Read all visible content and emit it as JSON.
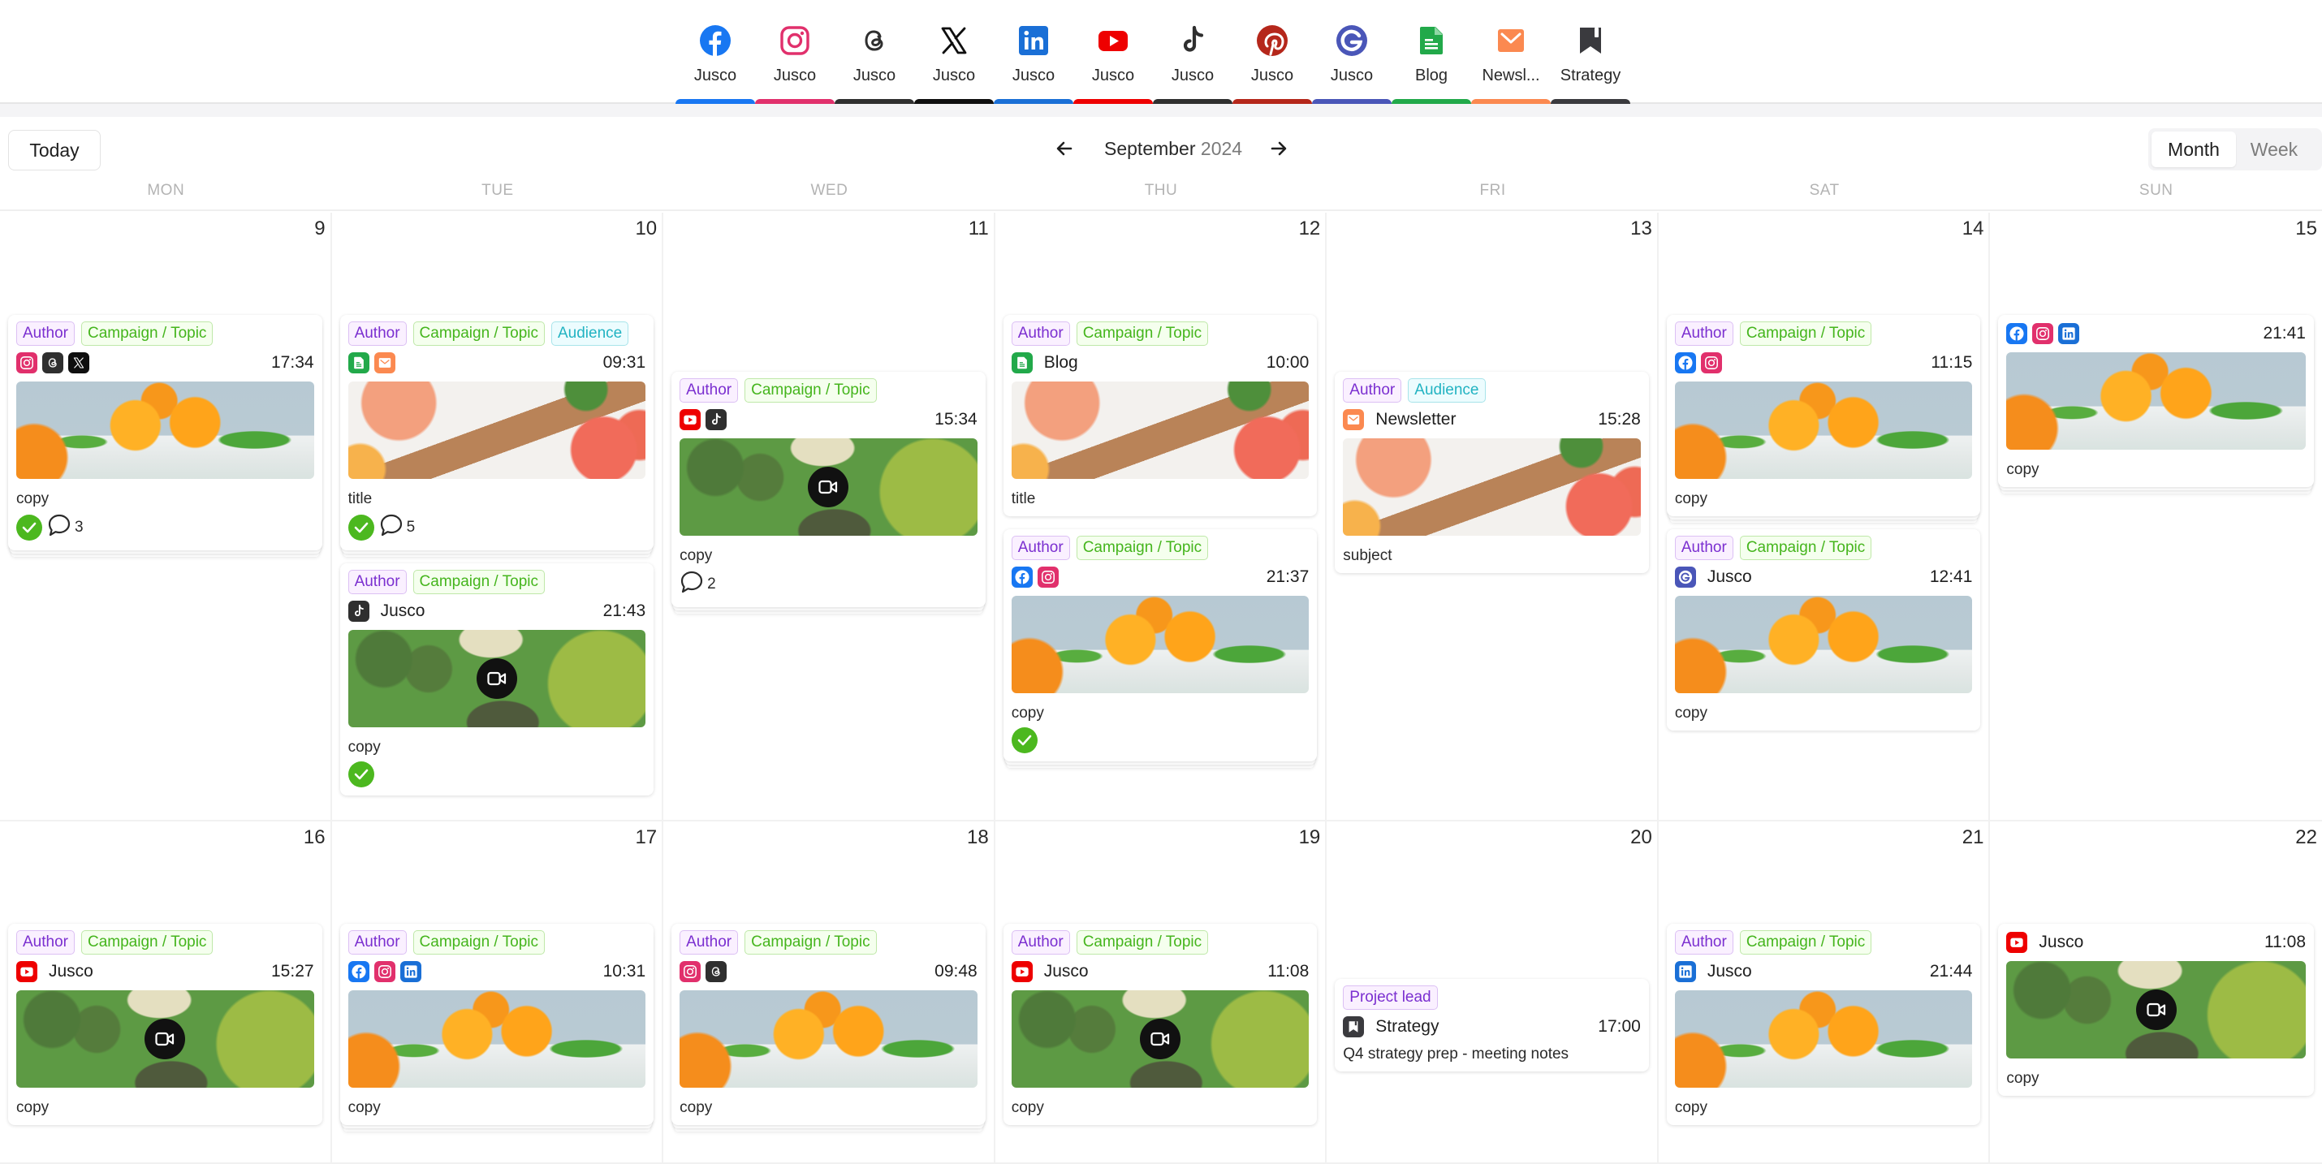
{
  "channels": [
    {
      "name": "facebook",
      "label": "Jusco",
      "color": "#1877f2"
    },
    {
      "name": "instagram",
      "label": "Jusco",
      "color": "#e1306c"
    },
    {
      "name": "threads",
      "label": "Jusco",
      "color": "#2f2f2f"
    },
    {
      "name": "x",
      "label": "Jusco",
      "color": "#0f0f0f"
    },
    {
      "name": "linkedin",
      "label": "Jusco",
      "color": "#1a6fd6"
    },
    {
      "name": "youtube",
      "label": "Jusco",
      "color": "#ee0000"
    },
    {
      "name": "tiktok",
      "label": "Jusco",
      "color": "#2f2f2f"
    },
    {
      "name": "pinterest",
      "label": "Jusco",
      "color": "#b5271b"
    },
    {
      "name": "google",
      "label": "Jusco",
      "color": "#4a56b8"
    },
    {
      "name": "blog",
      "label": "Blog",
      "color": "#22a94a"
    },
    {
      "name": "newsletter",
      "label": "Newsl...",
      "color": "#fb8950"
    },
    {
      "name": "strategy",
      "label": "Strategy",
      "color": "#3a3a3e"
    }
  ],
  "toolbar": {
    "today_label": "Today",
    "month": "September",
    "year": "2024",
    "prev_icon": "arrow-left-icon",
    "next_icon": "arrow-right-icon",
    "views": [
      "Month",
      "Week"
    ],
    "active_view": "Month"
  },
  "weekdays": [
    "MON",
    "TUE",
    "WED",
    "THU",
    "FRI",
    "SAT",
    "SUN"
  ],
  "weeks": [
    {
      "days": [
        {
          "day": "9",
          "offset": 1,
          "posts": [
            {
              "tags": [
                {
                  "type": "author",
                  "label": "Author"
                },
                {
                  "type": "campaign",
                  "label": "Campaign / Topic"
                }
              ],
              "icons": [
                "instagram",
                "threads",
                "x"
              ],
              "account": "",
              "time": "17:34",
              "image": "orange",
              "video": false,
              "caption": "copy",
              "approved": true,
              "comments": "3",
              "multi": true
            }
          ]
        },
        {
          "day": "10",
          "offset": 1,
          "posts": [
            {
              "tags": [
                {
                  "type": "author",
                  "label": "Author"
                },
                {
                  "type": "campaign",
                  "label": "Campaign / Topic"
                },
                {
                  "type": "audience",
                  "label": "Audience"
                }
              ],
              "icons": [
                "blog",
                "newsletter"
              ],
              "account": "",
              "time": "09:31",
              "image": "grapefruit",
              "video": false,
              "caption": "title",
              "approved": true,
              "comments": "5",
              "multi": true
            },
            {
              "tags": [
                {
                  "type": "author",
                  "label": "Author"
                },
                {
                  "type": "campaign",
                  "label": "Campaign / Topic"
                }
              ],
              "icons": [
                "tiktok"
              ],
              "account": "Jusco",
              "time": "21:43",
              "image": "greens",
              "video": true,
              "caption": "copy",
              "approved": true,
              "comments": "",
              "multi": false
            }
          ]
        },
        {
          "day": "11",
          "offset": 2,
          "posts": [
            {
              "tags": [
                {
                  "type": "author",
                  "label": "Author"
                },
                {
                  "type": "campaign",
                  "label": "Campaign / Topic"
                }
              ],
              "icons": [
                "youtube",
                "tiktok"
              ],
              "account": "",
              "time": "15:34",
              "image": "greens",
              "video": true,
              "caption": "copy",
              "approved": false,
              "comments": "2",
              "multi": true
            }
          ]
        },
        {
          "day": "12",
          "offset": 1,
          "posts": [
            {
              "tags": [
                {
                  "type": "author",
                  "label": "Author"
                },
                {
                  "type": "campaign",
                  "label": "Campaign / Topic"
                }
              ],
              "icons": [
                "blog"
              ],
              "account": "Blog",
              "time": "10:00",
              "image": "grapefruit",
              "video": false,
              "caption": "title",
              "approved": false,
              "comments": "",
              "multi": false
            },
            {
              "tags": [
                {
                  "type": "author",
                  "label": "Author"
                },
                {
                  "type": "campaign",
                  "label": "Campaign / Topic"
                }
              ],
              "icons": [
                "facebook",
                "instagram"
              ],
              "account": "",
              "time": "21:37",
              "image": "orange",
              "video": false,
              "caption": "copy",
              "approved": true,
              "comments": "",
              "multi": true
            }
          ]
        },
        {
          "day": "13",
          "offset": 2,
          "posts": [
            {
              "tags": [
                {
                  "type": "author",
                  "label": "Author"
                },
                {
                  "type": "audience",
                  "label": "Audience"
                }
              ],
              "icons": [
                "newsletter"
              ],
              "account": "Newsletter",
              "time": "15:28",
              "image": "grapefruit",
              "video": false,
              "caption": "subject",
              "approved": false,
              "comments": "",
              "multi": false
            }
          ]
        },
        {
          "day": "14",
          "offset": 1,
          "posts": [
            {
              "tags": [
                {
                  "type": "author",
                  "label": "Author"
                },
                {
                  "type": "campaign",
                  "label": "Campaign / Topic"
                }
              ],
              "icons": [
                "facebook",
                "instagram"
              ],
              "account": "",
              "time": "11:15",
              "image": "orange",
              "video": false,
              "caption": "copy",
              "approved": false,
              "comments": "",
              "multi": true
            },
            {
              "tags": [
                {
                  "type": "author",
                  "label": "Author"
                },
                {
                  "type": "campaign",
                  "label": "Campaign / Topic"
                }
              ],
              "icons": [
                "google"
              ],
              "account": "Jusco",
              "time": "12:41",
              "image": "orange",
              "video": false,
              "caption": "copy",
              "approved": false,
              "comments": "",
              "multi": false
            }
          ]
        },
        {
          "day": "15",
          "offset": 1,
          "posts": [
            {
              "tags": [],
              "icons": [
                "facebook",
                "instagram",
                "linkedin"
              ],
              "account": "",
              "time": "21:41",
              "image": "orange",
              "video": false,
              "caption": "copy",
              "approved": false,
              "comments": "",
              "multi": true
            }
          ]
        }
      ]
    },
    {
      "days": [
        {
          "day": "16",
          "offset": 1,
          "posts": [
            {
              "tags": [
                {
                  "type": "author",
                  "label": "Author"
                },
                {
                  "type": "campaign",
                  "label": "Campaign / Topic"
                }
              ],
              "icons": [
                "youtube"
              ],
              "account": "Jusco",
              "time": "15:27",
              "image": "greens",
              "video": true,
              "caption": "copy",
              "approved": false,
              "comments": "",
              "multi": false
            }
          ]
        },
        {
          "day": "17",
          "offset": 1,
          "posts": [
            {
              "tags": [
                {
                  "type": "author",
                  "label": "Author"
                },
                {
                  "type": "campaign",
                  "label": "Campaign / Topic"
                }
              ],
              "icons": [
                "facebook",
                "instagram",
                "linkedin"
              ],
              "account": "",
              "time": "10:31",
              "image": "orange",
              "video": false,
              "caption": "copy",
              "approved": false,
              "comments": "",
              "multi": true
            }
          ]
        },
        {
          "day": "18",
          "offset": 1,
          "posts": [
            {
              "tags": [
                {
                  "type": "author",
                  "label": "Author"
                },
                {
                  "type": "campaign",
                  "label": "Campaign / Topic"
                }
              ],
              "icons": [
                "instagram",
                "threads"
              ],
              "account": "",
              "time": "09:48",
              "image": "orange",
              "video": false,
              "caption": "copy",
              "approved": false,
              "comments": "",
              "multi": true
            }
          ]
        },
        {
          "day": "19",
          "offset": 1,
          "posts": [
            {
              "tags": [
                {
                  "type": "author",
                  "label": "Author"
                },
                {
                  "type": "campaign",
                  "label": "Campaign / Topic"
                }
              ],
              "icons": [
                "youtube"
              ],
              "account": "Jusco",
              "time": "11:08",
              "image": "greens",
              "video": true,
              "caption": "copy",
              "approved": false,
              "comments": "",
              "multi": false
            }
          ]
        },
        {
          "day": "20",
          "offset": 2,
          "posts": [
            {
              "tags": [
                {
                  "type": "lead",
                  "label": "Project lead"
                }
              ],
              "icons": [
                "strategy"
              ],
              "account": "Strategy",
              "time": "17:00",
              "image": "",
              "video": false,
              "caption": "Q4 strategy prep - meeting notes",
              "approved": false,
              "comments": "",
              "multi": false
            }
          ]
        },
        {
          "day": "21",
          "offset": 1,
          "posts": [
            {
              "tags": [
                {
                  "type": "author",
                  "label": "Author"
                },
                {
                  "type": "campaign",
                  "label": "Campaign / Topic"
                }
              ],
              "icons": [
                "linkedin"
              ],
              "account": "Jusco",
              "time": "21:44",
              "image": "orange",
              "video": false,
              "caption": "copy",
              "approved": false,
              "comments": "",
              "multi": false
            }
          ]
        },
        {
          "day": "22",
          "offset": 1,
          "posts": [
            {
              "tags": [],
              "icons": [
                "youtube"
              ],
              "account": "Jusco",
              "time": "11:08",
              "image": "greens",
              "video": true,
              "caption": "copy",
              "approved": false,
              "comments": "",
              "multi": false
            }
          ]
        }
      ]
    }
  ]
}
